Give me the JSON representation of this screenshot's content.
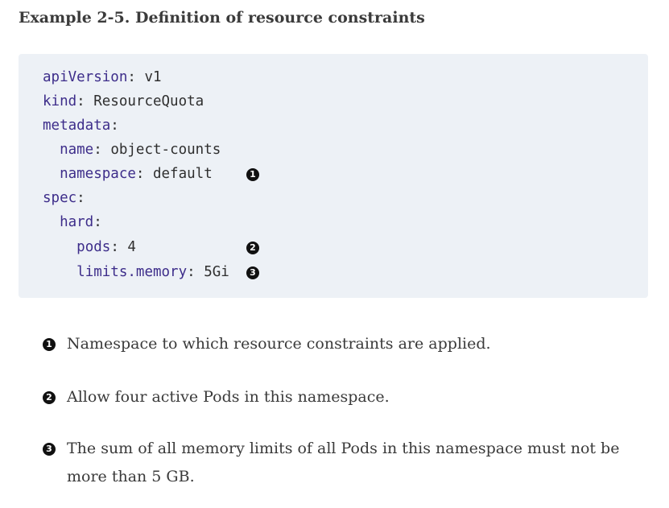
{
  "caption": "Example 2-5. Definition of resource constraints",
  "code": {
    "lines": [
      {
        "key": "apiVersion",
        "sep": ": ",
        "value": "v1"
      },
      {
        "key": "kind",
        "sep": ": ",
        "value": "ResourceQuota"
      },
      {
        "key": "metadata",
        "sep": ":",
        "value": ""
      },
      {
        "indent": "  ",
        "key": "name",
        "sep": ": ",
        "value": "object-counts"
      },
      {
        "indent": "  ",
        "key": "namespace",
        "sep": ": ",
        "value": "default"
      },
      {
        "key": "spec",
        "sep": ":",
        "value": ""
      },
      {
        "indent": "  ",
        "key": "hard",
        "sep": ":",
        "value": ""
      },
      {
        "indent": "    ",
        "key": "pods",
        "sep": ": ",
        "value": "4"
      },
      {
        "indent": "    ",
        "key": "limits.memory",
        "sep": ": ",
        "value": "5Gi"
      }
    ],
    "callouts": [
      "1",
      "2",
      "3"
    ]
  },
  "notes": [
    {
      "marker": "1",
      "text": "Namespace to which resource constraints are applied."
    },
    {
      "marker": "2",
      "text": "Allow four active Pods in this namespace."
    },
    {
      "marker": "3",
      "text": "The sum of all memory limits of all Pods in this namespace must not be more than 5 GB."
    }
  ],
  "colors": {
    "code_background": "#edf1f6",
    "yaml_key": "#3d2d8a",
    "callout_fill": "#111111"
  }
}
